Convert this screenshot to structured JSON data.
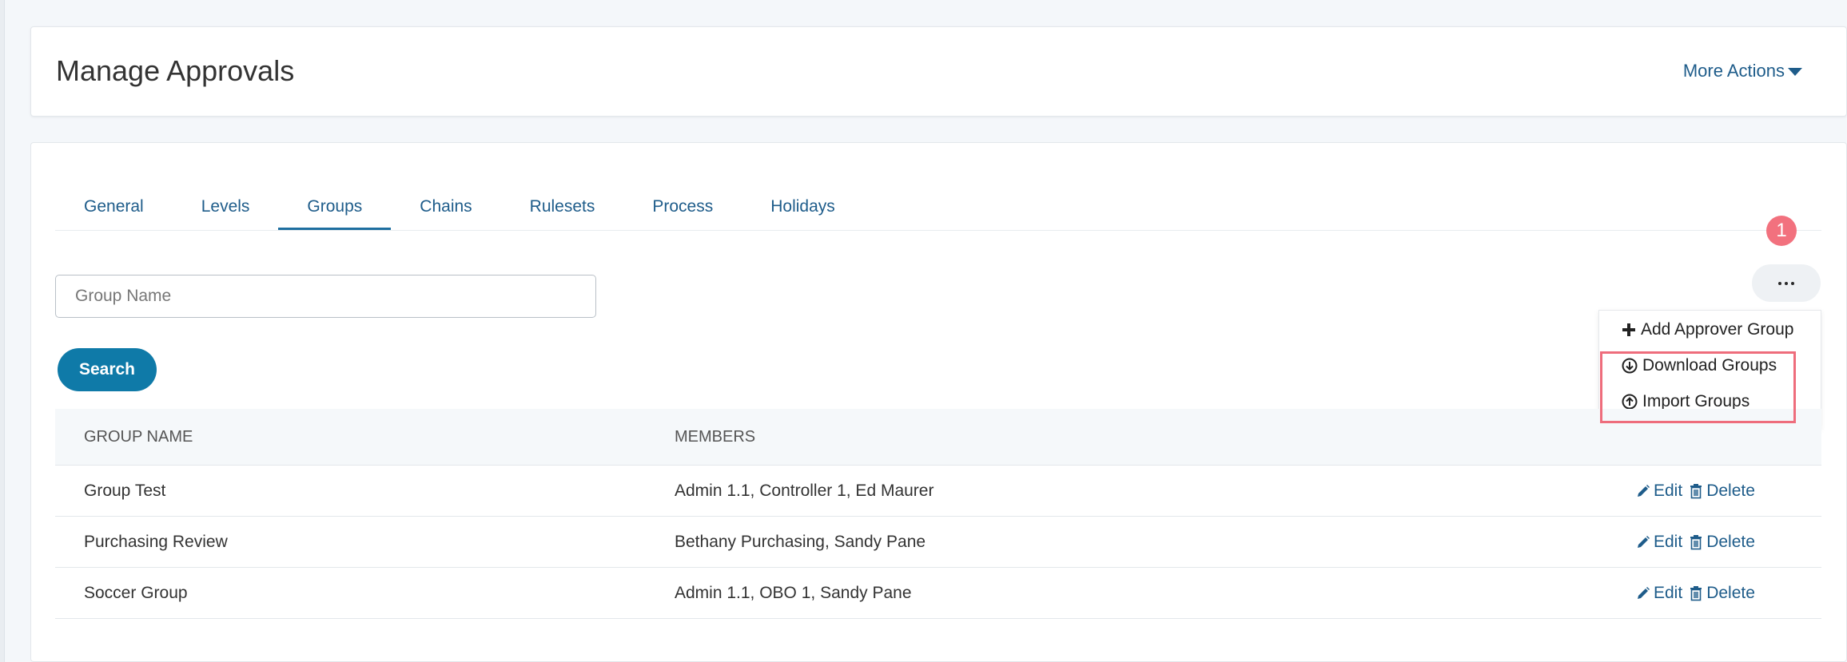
{
  "header": {
    "title": "Manage Approvals",
    "more_actions": "More Actions"
  },
  "tabs": [
    {
      "label": "General"
    },
    {
      "label": "Levels"
    },
    {
      "label": "Groups",
      "active": true
    },
    {
      "label": "Chains"
    },
    {
      "label": "Rulesets"
    },
    {
      "label": "Process"
    },
    {
      "label": "Holidays"
    }
  ],
  "badge": "1",
  "search": {
    "placeholder": "Group Name",
    "value": "",
    "button_label": "Search"
  },
  "dropdown": {
    "items": [
      {
        "label": "Add Approver Group",
        "icon": "plus-icon"
      },
      {
        "label": "Download Groups",
        "icon": "circle-arrow-down-icon"
      },
      {
        "label": "Import Groups",
        "icon": "circle-arrow-up-icon"
      }
    ]
  },
  "table": {
    "headers": [
      "GROUP NAME",
      "MEMBERS"
    ],
    "rows": [
      {
        "name": "Group Test",
        "members": "Admin 1.1, Controller 1, Ed Maurer"
      },
      {
        "name": "Purchasing Review",
        "members": "Bethany Purchasing, Sandy Pane"
      },
      {
        "name": "Soccer Group",
        "members": "Admin 1.1, OBO 1, Sandy Pane"
      }
    ],
    "edit_label": "Edit",
    "delete_label": "Delete"
  },
  "colors": {
    "link": "#1e5c8a",
    "primary_button": "#0f7aa8",
    "badge": "#f2717e",
    "highlight": "#ee6d7c"
  }
}
